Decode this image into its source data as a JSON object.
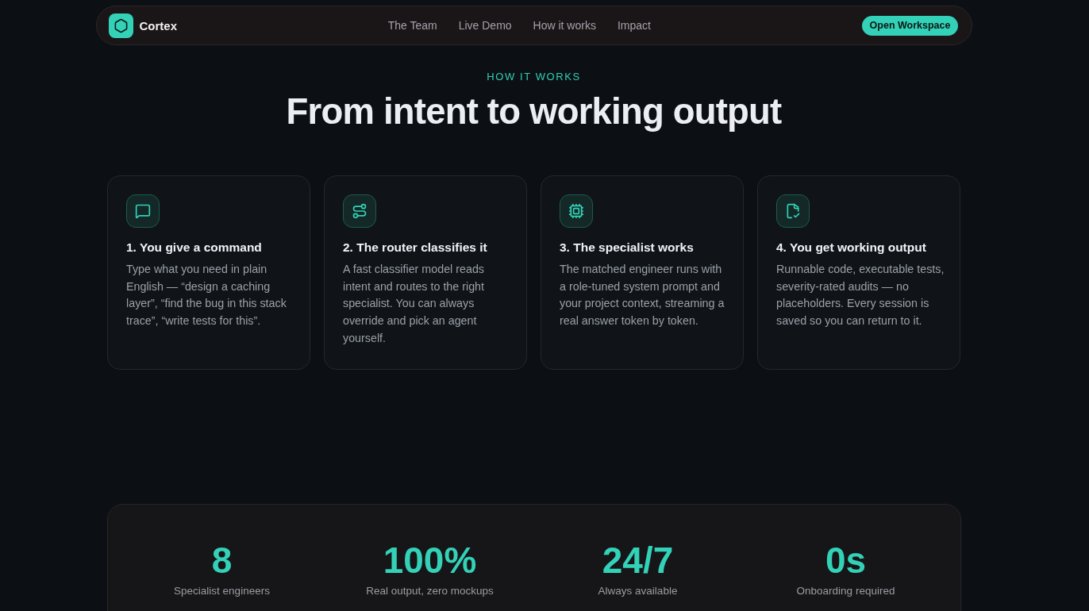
{
  "nav": {
    "brand": "Cortex",
    "links": [
      "The Team",
      "Live Demo",
      "How it works",
      "Impact"
    ],
    "cta": "Open Workspace"
  },
  "section": {
    "eyebrow": "HOW IT WORKS",
    "title": "From intent to working output"
  },
  "steps": [
    {
      "title": "1. You give a command",
      "description": "Type what you need in plain English — “design a caching layer”, “find the bug in this stack trace”, “write tests for this”."
    },
    {
      "title": "2. The router classifies it",
      "description": "A fast classifier model reads intent and routes to the right specialist. You can always override and pick an agent yourself."
    },
    {
      "title": "3. The specialist works",
      "description": "The matched engineer runs with a role-tuned system prompt and your project context, streaming a real answer token by token."
    },
    {
      "title": "4. You get working output",
      "description": "Runnable code, executable tests, severity-rated audits — no placeholders. Every session is saved so you can return to it."
    }
  ],
  "stats": [
    {
      "value": "8",
      "label": "Specialist engineers"
    },
    {
      "value": "100%",
      "label": "Real output, zero mockups"
    },
    {
      "value": "24/7",
      "label": "Always available"
    },
    {
      "value": "0s",
      "label": "Onboarding required"
    }
  ]
}
